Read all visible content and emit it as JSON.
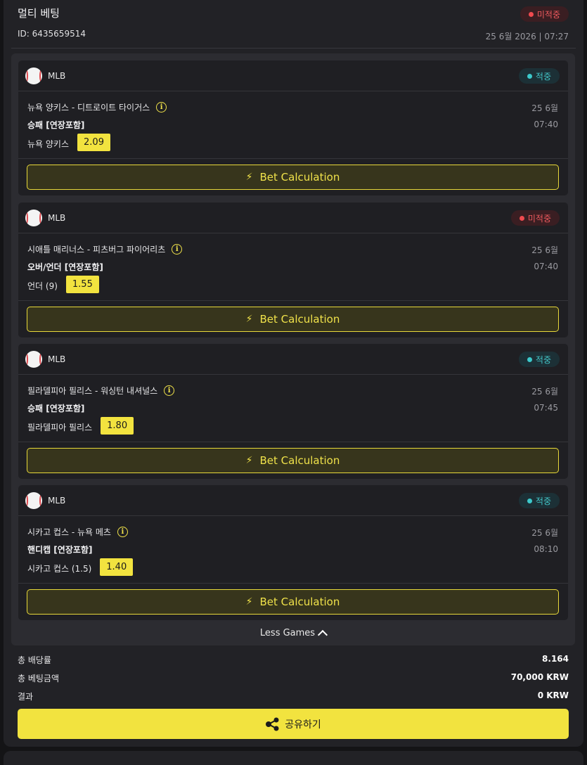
{
  "header": {
    "title": "멀티 베팅",
    "status": "미적중",
    "id": "ID: 6435659514",
    "datetime": "25 6월 2026 | 07:27"
  },
  "games": [
    {
      "league": "MLB",
      "status": "적중",
      "status_type": "win",
      "match": "뉴욕 양키스 - 디트로이트 타이거스",
      "date": "25 6월",
      "market": "승패 [연장포함]",
      "time": "07:40",
      "pick": "뉴욕 양키스",
      "odds": "2.09",
      "calc_label": "Bet Calculation"
    },
    {
      "league": "MLB",
      "status": "미적중",
      "status_type": "lose",
      "match": "시애틀 매리너스 - 피츠버그 파이어리츠",
      "date": "25 6월",
      "market": "오버/언더 [연장포함]",
      "time": "07:40",
      "pick": "언더 (9)",
      "odds": "1.55",
      "calc_label": "Bet Calculation"
    },
    {
      "league": "MLB",
      "status": "적중",
      "status_type": "win",
      "match": "필라델피아 필리스 - 워싱턴 내셔널스",
      "date": "25 6월",
      "market": "승패 [연장포함]",
      "time": "07:45",
      "pick": "필라델피아 필리스",
      "odds": "1.80",
      "calc_label": "Bet Calculation"
    },
    {
      "league": "MLB",
      "status": "적중",
      "status_type": "win",
      "match": "시카고 컵스 - 뉴욕 메츠",
      "date": "25 6월",
      "market": "핸디캡 [연장포함]",
      "time": "08:10",
      "pick": "시카고 컵스 (1.5)",
      "odds": "1.40",
      "calc_label": "Bet Calculation"
    }
  ],
  "less_games_label": "Less Games",
  "summary": {
    "total_odds_label": "총 배당률",
    "total_odds_value": "8.164",
    "total_stake_label": "총 베팅금액",
    "total_stake_value": "70,000 KRW",
    "result_label": "결과",
    "result_value": "0 KRW"
  },
  "share_label": "공유하기",
  "colors": {
    "accent": "#f2e33f",
    "win": "#3cc9cb",
    "lose": "#ef4a4f"
  },
  "icons": {
    "league": "baseball-icon",
    "info": "info-icon",
    "calc": "bolt-icon",
    "less": "chevron-up-icon",
    "share": "share-icon"
  }
}
